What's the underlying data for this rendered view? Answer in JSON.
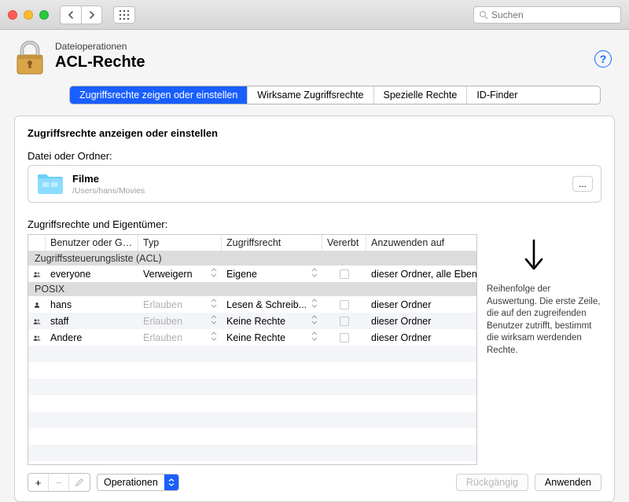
{
  "search_placeholder": "Suchen",
  "breadcrumb": "Dateioperationen",
  "page_title": "ACL-Rechte",
  "help_label": "?",
  "tabs": [
    "Zugriffsrechte zeigen oder einstellen",
    "Wirksame Zugriffsrechte",
    "Spezielle Rechte",
    "ID-Finder"
  ],
  "section_heading": "Zugriffsrechte anzeigen oder einstellen",
  "file_field_label": "Datei oder Ordner:",
  "file": {
    "name": "Filme",
    "path": "/Users/hans/Movies"
  },
  "more_btn": "...",
  "table_label": "Zugriffsrechte und Eigentümer:",
  "columns": {
    "user": "Benutzer oder Gr...",
    "type": "Typ",
    "right": "Zugriffsrecht",
    "inherit": "Vererbt",
    "apply": "Anzuwenden auf"
  },
  "group_acl": "Zugriffssteuerungsliste (ACL)",
  "group_posix": "POSIX",
  "rows": [
    {
      "user": "everyone",
      "type": "Verweigern",
      "type_dim": false,
      "right": "Eigene",
      "apply": "dieser Ordner, alle Ebenen",
      "multi": true
    },
    {
      "user": "hans",
      "type": "Erlauben",
      "type_dim": true,
      "right": "Lesen & Schreib...",
      "apply": "dieser Ordner",
      "multi": false
    },
    {
      "user": "staff",
      "type": "Erlauben",
      "type_dim": true,
      "right": "Keine Rechte",
      "apply": "dieser Ordner",
      "multi": true
    },
    {
      "user": "Andere",
      "type": "Erlauben",
      "type_dim": true,
      "right": "Keine Rechte",
      "apply": "dieser Ordner",
      "multi": true
    }
  ],
  "aside_text": "Reihenfolge der Auswertung. Die erste Zeile, die auf den zugreifenden Benutzer zutrifft, bestimmt die wirksam werdenden Rechte.",
  "footer": {
    "add": "+",
    "remove": "−",
    "ops_label": "Operationen",
    "undo": "Rückgängig",
    "apply": "Anwenden"
  }
}
